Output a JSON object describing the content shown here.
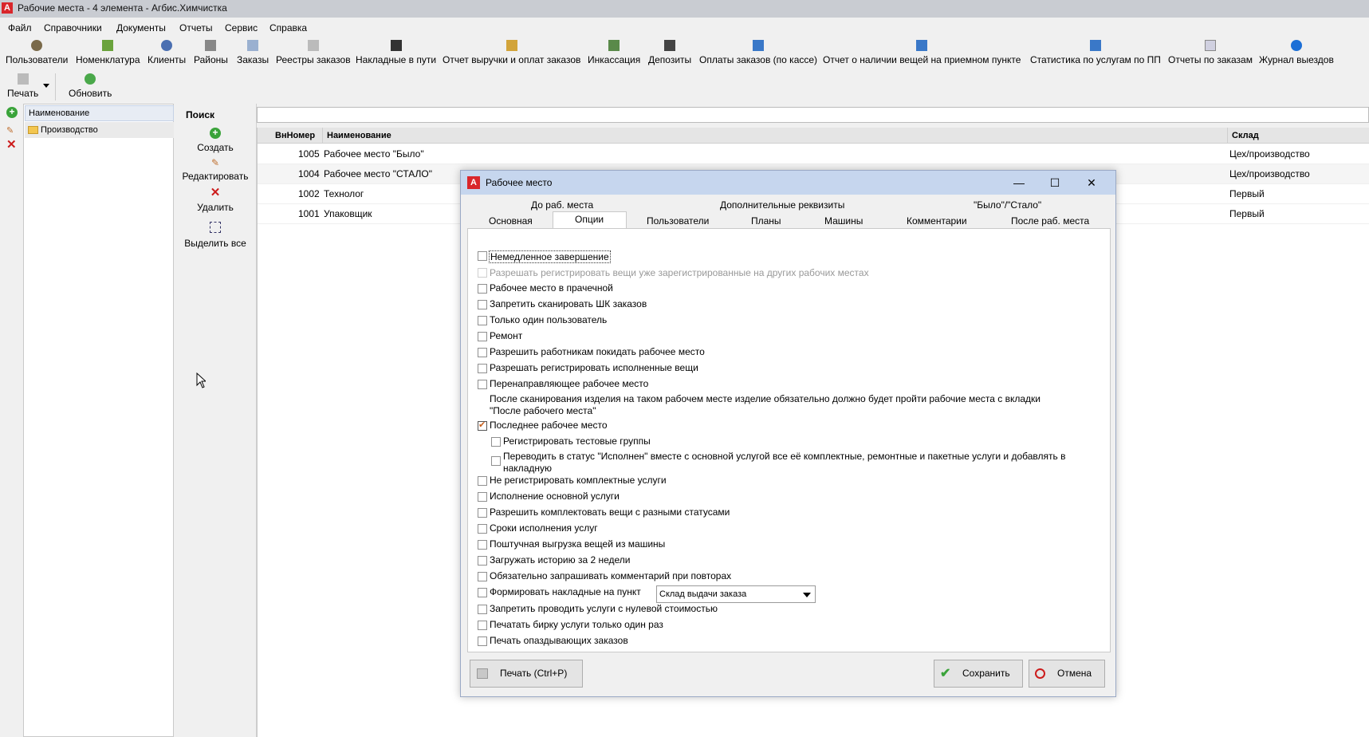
{
  "window": {
    "title": "Рабочие места - 4 элемента - Агбис.Химчистка"
  },
  "menu": [
    "Файл",
    "Справочники",
    "Документы",
    "Отчеты",
    "Сервис",
    "Справка"
  ],
  "toolbar": [
    "Пользователи",
    "Номенклатура",
    "Клиенты",
    "Районы",
    "Заказы",
    "Реестры заказов",
    "Накладные в пути",
    "Отчет выручки и оплат заказов",
    "Инкассация",
    "Депозиты",
    "Оплаты заказов (по кассе)",
    "Отчет о наличии вещей на приемном пункте",
    "Статистика по услугам по ПП",
    "Отчеты по заказам",
    "Журнал выездов"
  ],
  "toolbar2": {
    "print": "Печать",
    "refresh": "Обновить"
  },
  "tree": {
    "header": "Наименование",
    "items": [
      "Производство"
    ]
  },
  "actions": {
    "create": "Создать",
    "edit": "Редактировать",
    "delete": "Удалить",
    "select_all": "Выделить все"
  },
  "search": {
    "label": "Поиск",
    "value": ""
  },
  "grid": {
    "columns": [
      "ВнНомер",
      "Наименование",
      "Склад"
    ],
    "rows": [
      {
        "num": "1005",
        "name": "Рабочее место \"Было\"",
        "store": "Цех/производство"
      },
      {
        "num": "1004",
        "name": "Рабочее место \"СТАЛО\"",
        "store": "Цех/производство"
      },
      {
        "num": "1002",
        "name": "Технолог",
        "store": "Первый"
      },
      {
        "num": "1001",
        "name": "Упаковщик",
        "store": "Первый"
      }
    ]
  },
  "dialog": {
    "title": "Рабочее место",
    "tabs_row1": [
      "До раб. места",
      "Дополнительные реквизиты",
      "\"Было\"/\"Стало\""
    ],
    "tabs_row2": [
      "Основная",
      "Опции",
      "Пользователи",
      "Планы",
      "Машины",
      "Комментарии",
      "После раб. места"
    ],
    "active_tab": "Опции",
    "options": [
      {
        "label": "Немедленное завершение",
        "checked": false
      },
      {
        "label": "Разрешать регистрировать вещи уже зарегистрированные на других рабочих местах",
        "checked": false,
        "disabled": true
      },
      {
        "label": "Рабочее место в прачечной",
        "checked": false
      },
      {
        "label": "Запретить сканировать ШК заказов",
        "checked": false
      },
      {
        "label": "Только один пользователь",
        "checked": false
      },
      {
        "label": "Ремонт",
        "checked": false
      },
      {
        "label": "Разрешить работникам покидать рабочее место",
        "checked": false
      },
      {
        "label": "Разрешать регистрировать исполненные вещи",
        "checked": false
      },
      {
        "label": "Перенаправляющее рабочее место",
        "checked": false
      }
    ],
    "note": "После сканирования изделия на таком рабочем месте изделие обязательно должно будет пройти рабочие места с вкладки \"После рабочего места\"",
    "last_workplace": {
      "label": "Последнее рабочее место",
      "checked": true
    },
    "sub_options": [
      {
        "label": "Регистрировать тестовые группы",
        "checked": false
      },
      {
        "label": "Переводить в статус \"Исполнен\" вместе с основной услугой все её комплектные, ремонтные и пакетные услуги и добавлять в накладную",
        "checked": false
      }
    ],
    "options2": [
      {
        "label": "Не регистрировать комплектные услуги",
        "checked": false
      },
      {
        "label": "Исполнение основной услуги",
        "checked": false
      },
      {
        "label": "Разрешить комплектовать вещи с разными статусами",
        "checked": false
      },
      {
        "label": "Сроки исполнения услуг",
        "checked": false
      },
      {
        "label": "Поштучная выгрузка вещей из машины",
        "checked": false
      },
      {
        "label": "Загружать историю за 2 недели",
        "checked": false
      },
      {
        "label": "Обязательно запрашивать комментарий при повторах",
        "checked": false
      },
      {
        "label": "Формировать накладные на пункт",
        "checked": false
      },
      {
        "label": "Запретить проводить услуги с нулевой стоимостью",
        "checked": false
      },
      {
        "label": "Печатать бирку услуги только один раз",
        "checked": false
      },
      {
        "label": "Печать опаздывающих заказов",
        "checked": false
      }
    ],
    "combo_value": "Склад выдачи заказа",
    "buttons": {
      "print": "Печать (Ctrl+P)",
      "save": "Сохранить",
      "cancel": "Отмена"
    }
  }
}
